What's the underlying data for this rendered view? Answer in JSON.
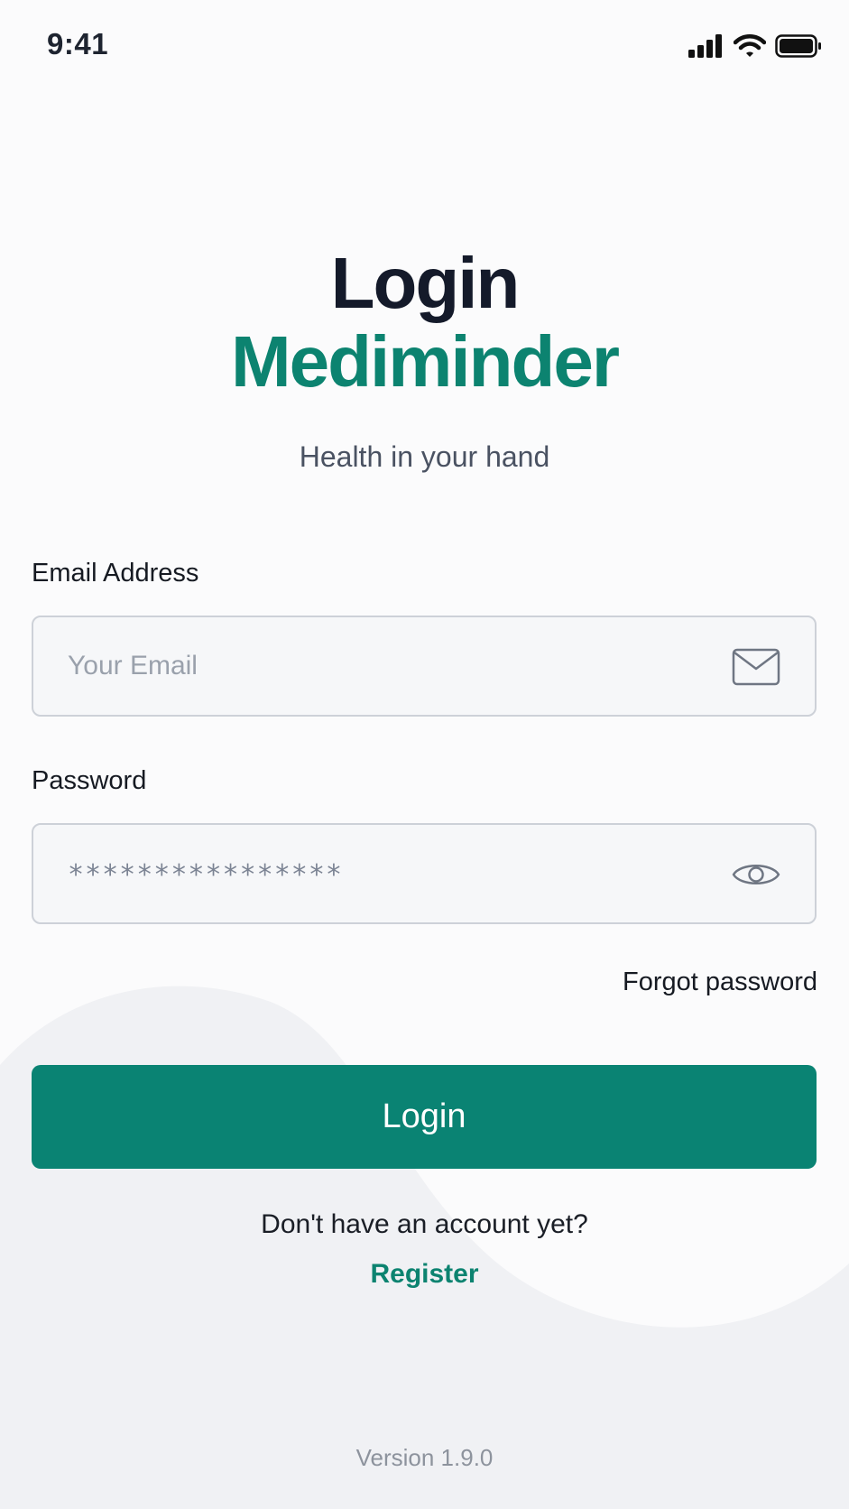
{
  "status_bar": {
    "time": "9:41",
    "icons": [
      "cellular-signal-icon",
      "wifi-icon",
      "battery-icon"
    ]
  },
  "header": {
    "title": "Login",
    "brand": "Mediminder",
    "tagline": "Health in your hand"
  },
  "form": {
    "email": {
      "label": "Email Address",
      "placeholder": "Your Email",
      "value": "",
      "icon": "envelope-icon"
    },
    "password": {
      "label": "Password",
      "masked_value": "****************",
      "icon": "eye-icon"
    },
    "forgot_label": "Forgot password",
    "submit_label": "Login"
  },
  "footer": {
    "prompt": "Don't have an account yet?",
    "register_label": "Register",
    "version": "Version 1.9.0"
  },
  "colors": {
    "brand": "#0c8370",
    "button": "#0a8373",
    "title": "#141a2a",
    "background": "#fbfbfc"
  }
}
